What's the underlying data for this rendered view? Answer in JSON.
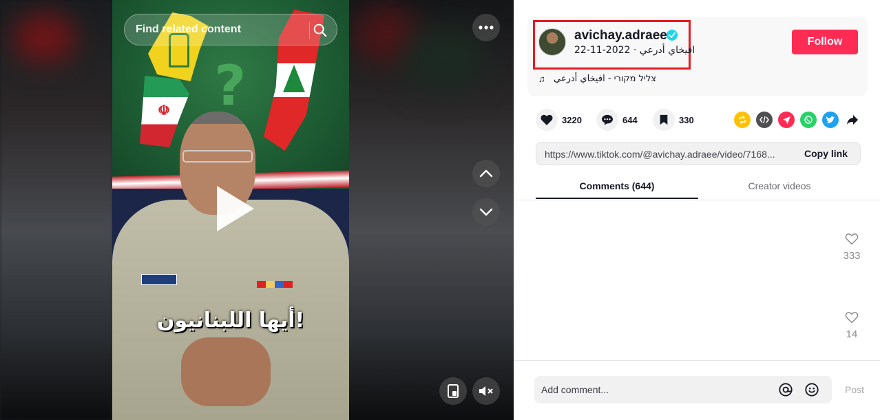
{
  "video": {
    "search_placeholder": "Find related content",
    "caption": "أيها اللبنانيون!",
    "icons": {
      "search": "search-icon",
      "more": "more-horizontal-icon",
      "up": "chevron-up-icon",
      "down": "chevron-down-icon",
      "miniplayer": "floating-player-icon",
      "mute": "muted-speaker-icon",
      "play": "play-icon"
    }
  },
  "author": {
    "username": "avichay.adraee",
    "display_name": "افيخاي أدرعي",
    "date": "2022-11-22",
    "subline": "افيخاي أدرعي · 2022-11-22",
    "verified": true,
    "follow_label": "Follow"
  },
  "music": {
    "text": "צליל מקורי - افيخاي أدرعي"
  },
  "actions": {
    "likes": "3220",
    "comments": "644",
    "saves": "330"
  },
  "share_icons": [
    "repost-icon",
    "embed-icon",
    "send-to-friends-icon",
    "whatsapp-icon",
    "twitter-icon",
    "share-arrow-icon"
  ],
  "link": {
    "url": "https://www.tiktok.com/@avichay.adraee/video/7168...",
    "copy_label": "Copy link"
  },
  "tabs": {
    "comments": "Comments (644)",
    "creator": "Creator videos"
  },
  "comments": [
    {
      "likes": "333"
    },
    {
      "likes": "14"
    }
  ],
  "composer": {
    "placeholder": "Add comment...",
    "post_label": "Post"
  },
  "colors": {
    "follow": "#fe2c55",
    "highlight_box": "#e31b23",
    "verified": "#20d5ec",
    "repost": "#ffc107",
    "embed": "#4f4f52",
    "send": "#fe2c55",
    "whatsapp": "#25d366",
    "twitter": "#1da1f2"
  }
}
